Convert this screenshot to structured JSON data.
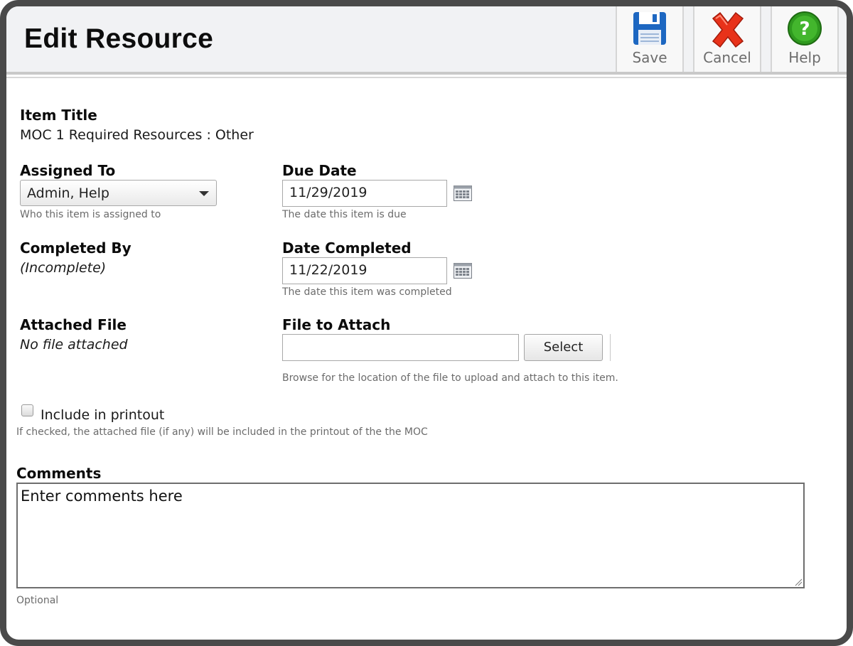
{
  "header": {
    "title": "Edit Resource"
  },
  "toolbar": {
    "save_label": "Save",
    "cancel_label": "Cancel",
    "help_label": "Help"
  },
  "item_title": {
    "label": "Item Title",
    "value": "MOC 1 Required Resources : Other"
  },
  "assigned_to": {
    "label": "Assigned To",
    "value": "Admin, Help",
    "hint": "Who this item is assigned to"
  },
  "due_date": {
    "label": "Due Date",
    "value": "11/29/2019",
    "hint": "The date this item is due"
  },
  "completed_by": {
    "label": "Completed By",
    "value": "(Incomplete)"
  },
  "date_completed": {
    "label": "Date Completed",
    "value": "11/22/2019",
    "hint": "The date this item was completed"
  },
  "attached_file": {
    "label": "Attached File",
    "value": "No file attached"
  },
  "file_to_attach": {
    "label": "File to Attach",
    "value": "",
    "button_label": "Select",
    "hint": "Browse for the location of the file to upload and attach to this item."
  },
  "include_printout": {
    "label": "Include in printout",
    "checked": false,
    "hint": "If checked, the attached file (if any) will be included in the printout of the the MOC"
  },
  "comments": {
    "label": "Comments",
    "value": "Enter comments here",
    "hint": "Optional"
  },
  "colors": {
    "frame": "#4a4a4a",
    "header_bg": "#f1f2f4",
    "save_icon": "#1d67c1",
    "cancel_icon": "#e8321a",
    "help_icon": "#2f9a1f"
  },
  "icons": {
    "save": "floppy-disk-icon",
    "cancel": "red-x-icon",
    "help": "question-mark-icon",
    "calendar": "calendar-icon",
    "dropdown": "chevron-down-icon"
  }
}
